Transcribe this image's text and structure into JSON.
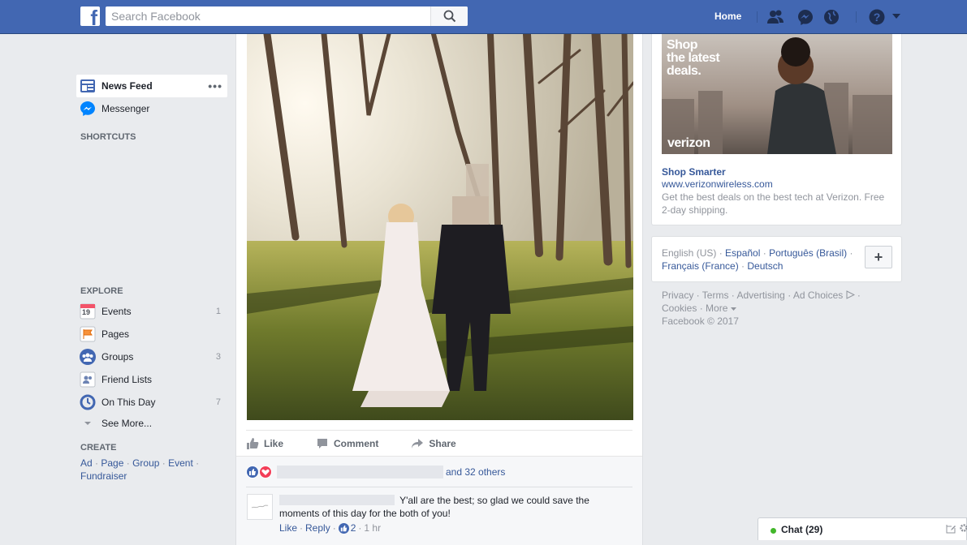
{
  "header": {
    "search_placeholder": "Search Facebook",
    "home_label": "Home"
  },
  "sidebar": {
    "news_feed": "News Feed",
    "messenger": "Messenger",
    "shortcuts_header": "SHORTCUTS",
    "explore_header": "EXPLORE",
    "explore_items": [
      {
        "label": "Events",
        "count": "1",
        "icon": "calendar-icon"
      },
      {
        "label": "Pages",
        "count": "",
        "icon": "flag-icon"
      },
      {
        "label": "Groups",
        "count": "3",
        "icon": "groups-icon"
      },
      {
        "label": "Friend Lists",
        "count": "",
        "icon": "friend-list-icon"
      },
      {
        "label": "On This Day",
        "count": "7",
        "icon": "clock-icon"
      }
    ],
    "see_more": "See More...",
    "create_header": "CREATE",
    "create_links": [
      "Ad",
      "Page",
      "Group",
      "Event",
      "Fundraiser"
    ],
    "calendar_day": "19"
  },
  "post": {
    "actions": [
      "Like",
      "Comment",
      "Share"
    ],
    "reactions_text": "and 32 others",
    "comment": {
      "text": "Y'all are the best; so glad we could save the moments of this day for the both of you!",
      "like": "Like",
      "reply": "Reply",
      "likes_count": "2",
      "time": "1 hr"
    }
  },
  "ad": {
    "headline_lines": [
      "Shop",
      "the latest",
      "deals."
    ],
    "brand": "verizon",
    "title": "Shop Smarter",
    "url": "www.verizonwireless.com",
    "description": "Get the best deals on the best tech at Verizon. Free 2-day shipping."
  },
  "languages": {
    "current": "English (US)",
    "others": [
      "Español",
      "Português (Brasil)",
      "Français (France)",
      "Deutsch"
    ],
    "add": "+"
  },
  "footer": {
    "links": [
      "Privacy",
      "Terms",
      "Advertising",
      "Ad Choices",
      "Cookies",
      "More"
    ],
    "copyright": "Facebook © 2017"
  },
  "chat": {
    "label": "Chat (29)"
  },
  "colors": {
    "brand_blue": "#4267b2",
    "link_blue": "#365899",
    "online_green": "#42b72a"
  }
}
